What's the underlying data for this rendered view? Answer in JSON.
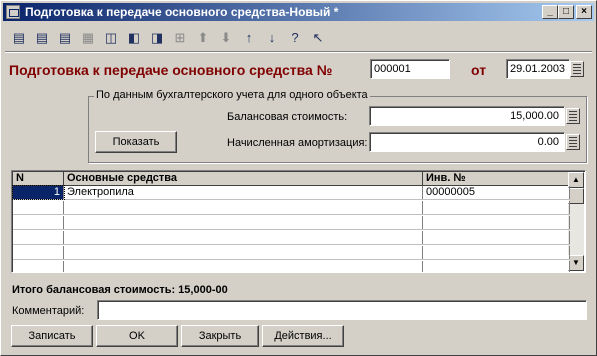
{
  "window": {
    "title": "Подготовка к передаче основного средства-Новый *"
  },
  "title_buttons": {
    "minimize": "_",
    "maximize": "□",
    "close": "×"
  },
  "toolbar": {
    "icons": [
      "add-row-icon",
      "add-copy-icon",
      "delete-row-icon",
      "edit-row-icon",
      "copy-icon",
      "cut-icon",
      "paste-icon",
      "end-edit-icon",
      "move-up-icon",
      "move-down-icon",
      "sort-asc-icon",
      "sort-desc-icon",
      "help-icon",
      "whats-this-icon"
    ],
    "glyphs": [
      "▤",
      "▤",
      "▤",
      "▦",
      "◫",
      "◧",
      "◨",
      "⊞",
      "⬆",
      "⬇",
      "↑",
      "↓",
      "?",
      "↖"
    ]
  },
  "header": {
    "title": "Подготовка к передаче основного средства №",
    "number": "000001",
    "date_label": "от",
    "date": "29.01.2003"
  },
  "group": {
    "caption": "По данным бухгалтерского учета для одного объекта",
    "balance_label": "Балансовая стоимость:",
    "balance_value": "15,000.00",
    "depreciation_label": "Начисленная амортизация:",
    "depreciation_value": "0.00",
    "show_button": "Показать"
  },
  "table": {
    "columns": [
      "N",
      "Основные средства",
      "Инв. №"
    ],
    "rows": [
      {
        "n": "1",
        "asset": "Электропила",
        "inv": "00000005"
      },
      {
        "n": "",
        "asset": "",
        "inv": ""
      },
      {
        "n": "",
        "asset": "",
        "inv": ""
      },
      {
        "n": "",
        "asset": "",
        "inv": ""
      },
      {
        "n": "",
        "asset": "",
        "inv": ""
      },
      {
        "n": "",
        "asset": "",
        "inv": ""
      }
    ]
  },
  "total": "Итого балансовая стоимость: 15,000-00",
  "comment": {
    "label": "Комментарий:",
    "value": ""
  },
  "buttons": {
    "save": "Записать",
    "ok": "OK",
    "close": "Закрыть",
    "actions": "Действия..."
  },
  "colors": {
    "title_start": "#0a246a",
    "title_end": "#a6caf0",
    "heading": "#800000",
    "selection": "#0a246a"
  }
}
